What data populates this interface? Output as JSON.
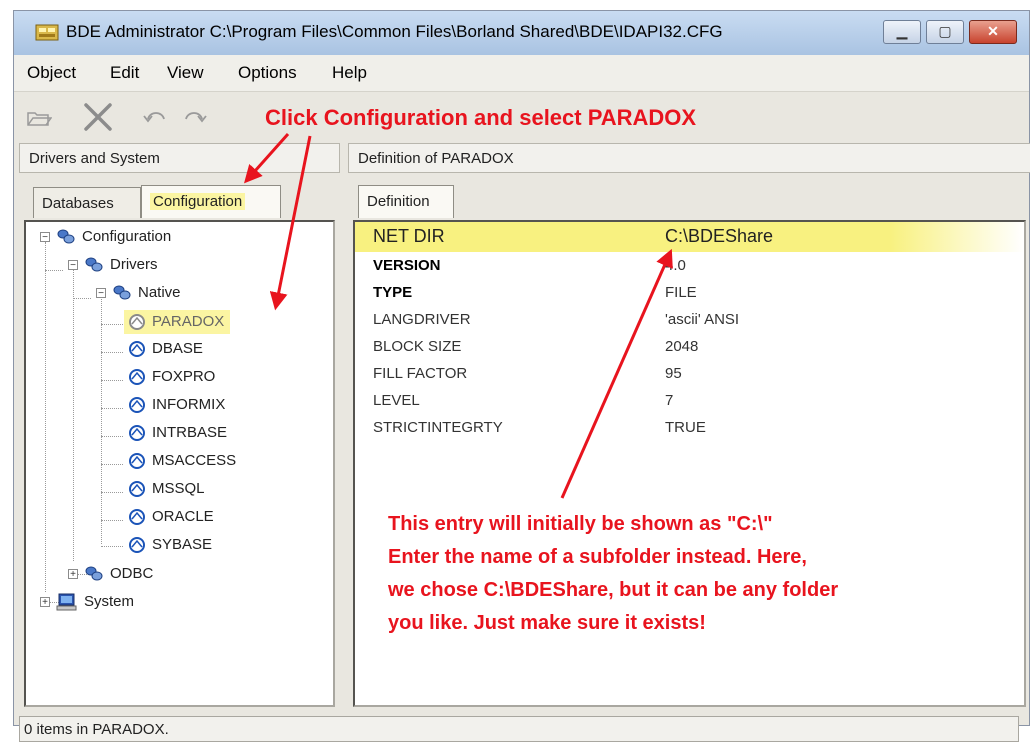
{
  "window": {
    "title": "BDE Administrator  C:\\Program Files\\Common Files\\Borland Shared\\BDE\\IDAPI32.CFG"
  },
  "menu": [
    "Object",
    "Edit",
    "View",
    "Options",
    "Help"
  ],
  "left_pane": {
    "header": "Drivers and System",
    "tabs": [
      "Databases",
      "Configuration"
    ],
    "active_tab": "Configuration",
    "tree": {
      "root": "Configuration",
      "drivers": "Drivers",
      "native": "Native",
      "native_items": [
        "PARADOX",
        "DBASE",
        "FOXPRO",
        "INFORMIX",
        "INTRBASE",
        "MSACCESS",
        "MSSQL",
        "ORACLE",
        "SYBASE"
      ],
      "selected": "PARADOX",
      "odbc": "ODBC",
      "system": "System"
    }
  },
  "right_pane": {
    "header": "Definition of PARADOX",
    "tab": "Definition",
    "rows": [
      {
        "key": "NET DIR",
        "value": "C:\\BDEShare"
      },
      {
        "key": "VERSION",
        "value": "4.0"
      },
      {
        "key": "TYPE",
        "value": "FILE"
      },
      {
        "key": "LANGDRIVER",
        "value": "'ascii' ANSI"
      },
      {
        "key": "BLOCK SIZE",
        "value": "2048"
      },
      {
        "key": "FILL FACTOR",
        "value": "95"
      },
      {
        "key": "LEVEL",
        "value": "7"
      },
      {
        "key": "STRICTINTEGRTY",
        "value": "TRUE"
      }
    ]
  },
  "status": "0 items in PARADOX.",
  "annotations": {
    "top": "Click Configuration and select PARADOX",
    "body": [
      "This entry will initially be shown as \"C:\\\"",
      "Enter the name of a subfolder instead.  Here,",
      "we chose C:\\BDEShare, but it can be any folder",
      "you like.  Just make sure it exists!"
    ]
  },
  "colors": {
    "annotation": "#e8141e",
    "highlight": "#f8f180",
    "driver_icon": "#1b54b8"
  },
  "icons": {
    "app": "bde-app-icon",
    "toolbar": [
      "open-folder-icon",
      "delete-x-icon",
      "undo-icon",
      "redo-icon"
    ],
    "tree_folder": "database-cluster-icon",
    "driver": "driver-globe-icon",
    "system": "computer-icon"
  }
}
